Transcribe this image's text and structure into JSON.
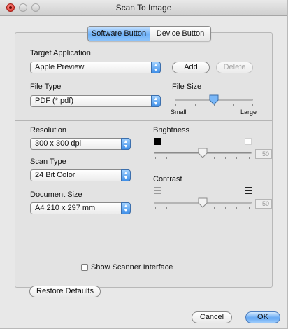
{
  "window": {
    "title": "Scan To Image"
  },
  "tabs": [
    {
      "label": "Software Button",
      "active": true
    },
    {
      "label": "Device Button",
      "active": false
    }
  ],
  "target_application": {
    "label": "Target Application",
    "value": "Apple Preview",
    "add_label": "Add",
    "delete_label": "Delete"
  },
  "file_type": {
    "label": "File Type",
    "value": "PDF (*.pdf)"
  },
  "file_size": {
    "label": "File Size",
    "min_label": "Small",
    "max_label": "Large",
    "level": 0.5
  },
  "resolution": {
    "label": "Resolution",
    "value": "300 x 300 dpi"
  },
  "scan_type": {
    "label": "Scan Type",
    "value": "24 Bit Color"
  },
  "document_size": {
    "label": "Document Size",
    "value": "A4  210 x 297 mm"
  },
  "brightness": {
    "label": "Brightness",
    "value": "50",
    "level": 0.5
  },
  "contrast": {
    "label": "Contrast",
    "value": "50",
    "level": 0.5
  },
  "show_scanner_interface": {
    "label": "Show Scanner Interface",
    "checked": false
  },
  "restore_defaults_label": "Restore Defaults",
  "footer": {
    "cancel_label": "Cancel",
    "ok_label": "OK"
  },
  "icons": {
    "popup_arrow": "up-down-arrows-icon",
    "slider_thumb": "slider-thumb-icon"
  }
}
